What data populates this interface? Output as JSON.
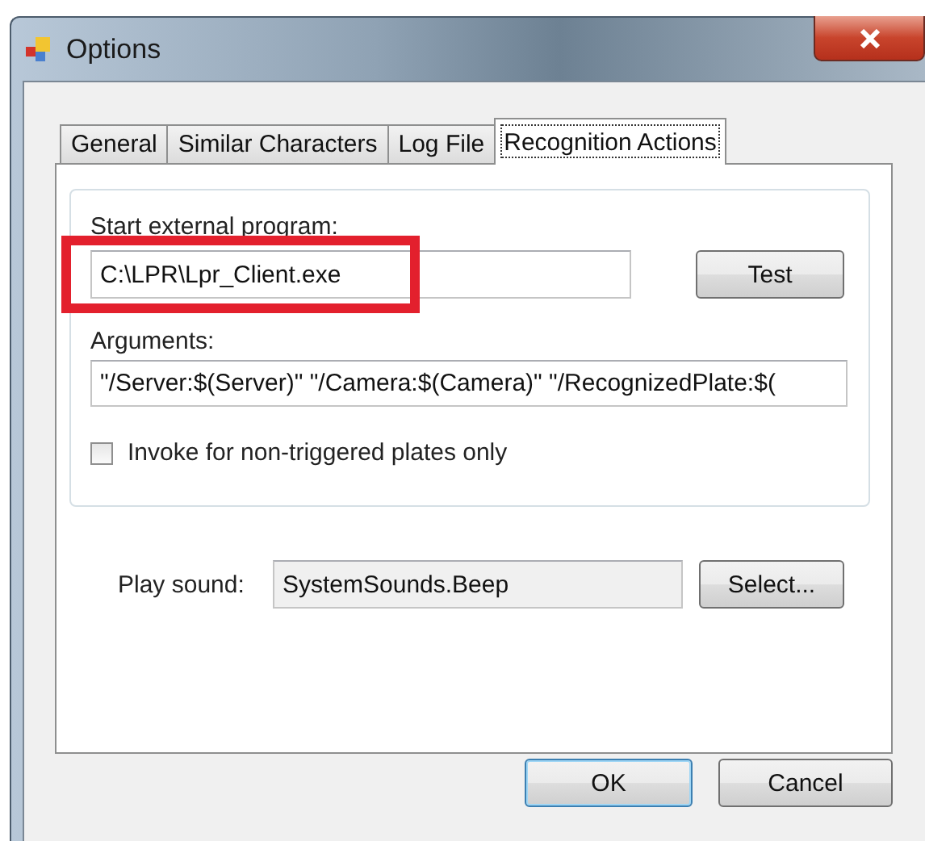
{
  "window": {
    "title": "Options"
  },
  "tabs": [
    {
      "label": "General",
      "selected": false
    },
    {
      "label": "Similar Characters",
      "selected": false
    },
    {
      "label": "Log File",
      "selected": false
    },
    {
      "label": "Recognition Actions",
      "selected": true
    }
  ],
  "program": {
    "label": "Start external program:",
    "value": "C:\\LPR\\Lpr_Client.exe",
    "highlighted": true,
    "button": "Test"
  },
  "arguments": {
    "label": "Arguments:",
    "value": "\"/Server:$(Server)\" \"/Camera:$(Camera)\" \"/RecognizedPlate:$("
  },
  "invoke_option": {
    "label": "Invoke for non-triggered plates only",
    "checked": false
  },
  "sound": {
    "label": "Play sound:",
    "value": "SystemSounds.Beep",
    "button": "Select..."
  },
  "buttons": [
    {
      "label": "OK",
      "default": true
    },
    {
      "label": "Cancel",
      "default": false
    }
  ]
}
